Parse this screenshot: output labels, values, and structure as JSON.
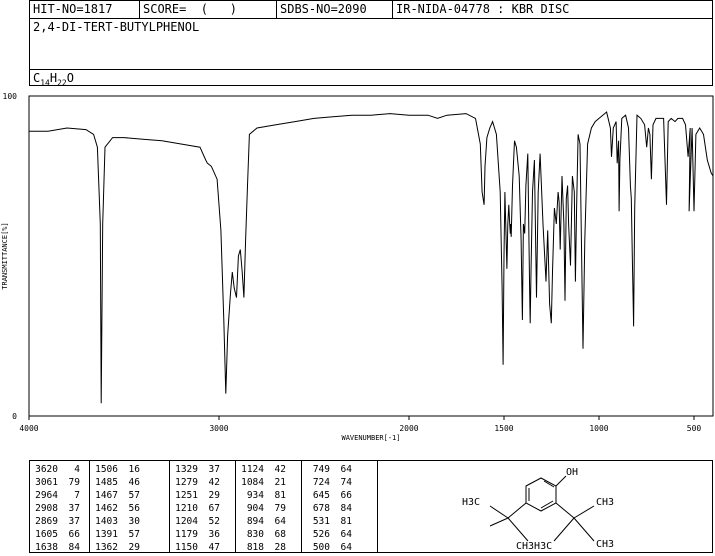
{
  "header": {
    "hit_no": "HIT-NO=1817",
    "score": "SCORE=  (   )",
    "sdbs_no": "SDBS-NO=2090",
    "ir_nida": "IR-NIDA-04778 : KBR DISC",
    "compound_name": "2,4-DI-TERT-BUTYLPHENOL",
    "formula": {
      "c": "C",
      "c_n": "14",
      "h": "H",
      "h_n": "22",
      "o": "O"
    }
  },
  "chart_data": {
    "type": "line",
    "xlabel": "WAVENUMBER[-1]",
    "ylabel": "TRANSMITTANCE[%]",
    "xlim": [
      4000,
      400
    ],
    "ylim": [
      0,
      100
    ],
    "x_reversed": true,
    "xticks": [
      4000,
      3000,
      2000,
      1500,
      1000,
      500
    ],
    "xtick_labels": [
      "4000",
      "3000",
      "2000",
      "1500",
      "1000",
      "500"
    ],
    "yticks": [
      0,
      100
    ],
    "ytick_labels": [
      "0",
      "100"
    ],
    "series": [
      {
        "color": "#000000",
        "points": [
          [
            4000,
            89
          ],
          [
            3900,
            89
          ],
          [
            3800,
            90
          ],
          [
            3700,
            89.5
          ],
          [
            3660,
            88
          ],
          [
            3640,
            84
          ],
          [
            3625,
            60
          ],
          [
            3620,
            4
          ],
          [
            3612,
            60
          ],
          [
            3600,
            84
          ],
          [
            3560,
            87
          ],
          [
            3500,
            87
          ],
          [
            3400,
            86.5
          ],
          [
            3300,
            86
          ],
          [
            3200,
            85
          ],
          [
            3100,
            84
          ],
          [
            3070,
            80
          ],
          [
            3061,
            79
          ],
          [
            3040,
            78
          ],
          [
            3010,
            74
          ],
          [
            2990,
            58
          ],
          [
            2975,
            30
          ],
          [
            2964,
            7
          ],
          [
            2955,
            25
          ],
          [
            2940,
            38
          ],
          [
            2930,
            45
          ],
          [
            2920,
            40
          ],
          [
            2908,
            37
          ],
          [
            2898,
            50
          ],
          [
            2888,
            52
          ],
          [
            2878,
            45
          ],
          [
            2869,
            37
          ],
          [
            2860,
            55
          ],
          [
            2850,
            72
          ],
          [
            2840,
            88
          ],
          [
            2800,
            90
          ],
          [
            2700,
            91
          ],
          [
            2600,
            92
          ],
          [
            2500,
            93
          ],
          [
            2400,
            93.5
          ],
          [
            2300,
            94
          ],
          [
            2200,
            94
          ],
          [
            2100,
            94.5
          ],
          [
            2000,
            94
          ],
          [
            1900,
            94
          ],
          [
            1850,
            93
          ],
          [
            1800,
            94
          ],
          [
            1700,
            94.5
          ],
          [
            1650,
            93
          ],
          [
            1625,
            85
          ],
          [
            1615,
            70
          ],
          [
            1605,
            66
          ],
          [
            1600,
            78
          ],
          [
            1590,
            87
          ],
          [
            1575,
            90
          ],
          [
            1560,
            92
          ],
          [
            1540,
            88
          ],
          [
            1520,
            70
          ],
          [
            1510,
            40
          ],
          [
            1505,
            16
          ],
          [
            1500,
            50
          ],
          [
            1495,
            70
          ],
          [
            1490,
            58
          ],
          [
            1485,
            46
          ],
          [
            1480,
            60
          ],
          [
            1475,
            66
          ],
          [
            1470,
            60
          ],
          [
            1467,
            57
          ],
          [
            1465,
            60
          ],
          [
            1462,
            56
          ],
          [
            1455,
            72
          ],
          [
            1445,
            86
          ],
          [
            1435,
            84
          ],
          [
            1420,
            75
          ],
          [
            1410,
            55
          ],
          [
            1403,
            30
          ],
          [
            1398,
            60
          ],
          [
            1391,
            57
          ],
          [
            1385,
            72
          ],
          [
            1375,
            82
          ],
          [
            1365,
            40
          ],
          [
            1362,
            29
          ],
          [
            1358,
            45
          ],
          [
            1350,
            70
          ],
          [
            1340,
            80
          ],
          [
            1329,
            37
          ],
          [
            1320,
            70
          ],
          [
            1310,
            82
          ],
          [
            1295,
            60
          ],
          [
            1279,
            42
          ],
          [
            1270,
            58
          ],
          [
            1260,
            35
          ],
          [
            1251,
            29
          ],
          [
            1245,
            45
          ],
          [
            1235,
            65
          ],
          [
            1225,
            60
          ],
          [
            1215,
            70
          ],
          [
            1210,
            67
          ],
          [
            1204,
            52
          ],
          [
            1195,
            75
          ],
          [
            1185,
            60
          ],
          [
            1179,
            36
          ],
          [
            1172,
            68
          ],
          [
            1165,
            72
          ],
          [
            1160,
            60
          ],
          [
            1150,
            47
          ],
          [
            1140,
            75
          ],
          [
            1130,
            70
          ],
          [
            1124,
            42
          ],
          [
            1118,
            65
          ],
          [
            1110,
            88
          ],
          [
            1100,
            85
          ],
          [
            1084,
            21
          ],
          [
            1075,
            55
          ],
          [
            1060,
            85
          ],
          [
            1040,
            90
          ],
          [
            1020,
            92
          ],
          [
            1000,
            93
          ],
          [
            980,
            94
          ],
          [
            960,
            95
          ],
          [
            940,
            90
          ],
          [
            934,
            81
          ],
          [
            925,
            90
          ],
          [
            910,
            92
          ],
          [
            904,
            79
          ],
          [
            897,
            86
          ],
          [
            894,
            64
          ],
          [
            890,
            80
          ],
          [
            880,
            93
          ],
          [
            860,
            94
          ],
          [
            845,
            90
          ],
          [
            835,
            72
          ],
          [
            830,
            68
          ],
          [
            825,
            50
          ],
          [
            820,
            35
          ],
          [
            818,
            28
          ],
          [
            812,
            65
          ],
          [
            800,
            94
          ],
          [
            780,
            93
          ],
          [
            760,
            91
          ],
          [
            749,
            84
          ],
          [
            740,
            90
          ],
          [
            732,
            88
          ],
          [
            724,
            74
          ],
          [
            716,
            91
          ],
          [
            700,
            93
          ],
          [
            660,
            93
          ],
          [
            645,
            66
          ],
          [
            636,
            92
          ],
          [
            620,
            93
          ],
          [
            600,
            92
          ],
          [
            585,
            93
          ],
          [
            560,
            93
          ],
          [
            545,
            91
          ],
          [
            531,
            81
          ],
          [
            520,
            90
          ],
          [
            526,
            64
          ],
          [
            510,
            90
          ],
          [
            500,
            64
          ],
          [
            490,
            88
          ],
          [
            470,
            90
          ],
          [
            450,
            88
          ],
          [
            430,
            80
          ],
          [
            410,
            76
          ],
          [
            400,
            75
          ]
        ]
      }
    ],
    "grid": false,
    "peak_table": [
      [
        [
          3620,
          4
        ],
        [
          3061,
          79
        ],
        [
          2964,
          7
        ],
        [
          2908,
          37
        ],
        [
          2869,
          37
        ],
        [
          1605,
          66
        ],
        [
          1638,
          84
        ]
      ],
      [
        [
          1506,
          16
        ],
        [
          1485,
          46
        ],
        [
          1467,
          57
        ],
        [
          1462,
          56
        ],
        [
          1403,
          30
        ],
        [
          1391,
          57
        ],
        [
          1362,
          29
        ]
      ],
      [
        [
          1329,
          37
        ],
        [
          1279,
          42
        ],
        [
          1251,
          29
        ],
        [
          1210,
          67
        ],
        [
          1204,
          52
        ],
        [
          1179,
          36
        ],
        [
          1150,
          47
        ]
      ],
      [
        [
          1124,
          42
        ],
        [
          1084,
          21
        ],
        [
          934,
          81
        ],
        [
          904,
          79
        ],
        [
          894,
          64
        ],
        [
          830,
          68
        ],
        [
          818,
          28
        ]
      ],
      [
        [
          749,
          64
        ],
        [
          724,
          74
        ],
        [
          645,
          66
        ],
        [
          678,
          84
        ],
        [
          531,
          81
        ],
        [
          526,
          64
        ],
        [
          500,
          64
        ]
      ]
    ]
  },
  "structure": {
    "oh": "OH",
    "left_h3c": "H3C",
    "right_ch3_top": "CH3",
    "right_ch3_bot": "CH3",
    "bottom_label": "CH3H3C"
  }
}
